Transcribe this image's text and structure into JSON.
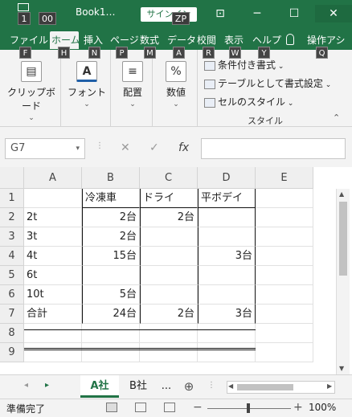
{
  "window": {
    "title": "Book1…",
    "signin_label": "サインイン",
    "keytips_top": [
      "1",
      "00",
      "ZP"
    ],
    "minimize_icon": "─",
    "maximize_icon": "☐",
    "close_icon": "✕",
    "ribbon_display_icon": "⊡",
    "colors": {
      "accent": "#217346",
      "keytip": "#444444"
    }
  },
  "ribbon_tabs": [
    {
      "label": "ファイル",
      "key": "F"
    },
    {
      "label": "ホーム",
      "key": "H"
    },
    {
      "label": "挿入",
      "key": "N"
    },
    {
      "label": "ページ",
      "key": "P"
    },
    {
      "label": "数式",
      "key": "M"
    },
    {
      "label": "データ",
      "key": "A"
    },
    {
      "label": "校閲",
      "key": "R"
    },
    {
      "label": "表示",
      "key": "W"
    },
    {
      "label": "ヘルプ",
      "key": "Y"
    },
    {
      "label": "操作アシ",
      "key": "Q"
    }
  ],
  "ribbon": {
    "clipboard_label": "クリップボード",
    "font_label": "フォント",
    "alignment_label": "配置",
    "number_label": "数値",
    "conditional_format": "条件付き書式",
    "format_as_table": "テーブルとして書式設定",
    "cell_styles": "セルのスタイル",
    "styles_group_label": "スタイル"
  },
  "formula_bar": {
    "name_box": "G7",
    "cancel_icon": "✕",
    "enter_icon": "✓",
    "function_icon": "fx",
    "formula": ""
  },
  "grid": {
    "columns": [
      "A",
      "B",
      "C",
      "D",
      "E"
    ],
    "rows": [
      "1",
      "2",
      "3",
      "4",
      "5",
      "6",
      "7",
      "8",
      "9"
    ],
    "cells": [
      [
        "",
        "冷凍車",
        "ドライ",
        "平ボデイ",
        ""
      ],
      [
        "2t",
        "2台",
        "2台",
        "",
        ""
      ],
      [
        "3t",
        "2台",
        "",
        "",
        ""
      ],
      [
        "4t",
        "15台",
        "",
        "3台",
        ""
      ],
      [
        "6t",
        "",
        "",
        "",
        ""
      ],
      [
        "10t",
        "5台",
        "",
        "",
        ""
      ],
      [
        "合計",
        "24台",
        "2台",
        "3台",
        ""
      ],
      [
        "",
        "",
        "",
        "",
        ""
      ],
      [
        "",
        "",
        "",
        "",
        ""
      ]
    ]
  },
  "sheets": {
    "tabs": [
      "A社",
      "B社"
    ],
    "more_label": "...",
    "add_icon": "⊕"
  },
  "status": {
    "ready": "準備完了",
    "zoom": "100%"
  }
}
